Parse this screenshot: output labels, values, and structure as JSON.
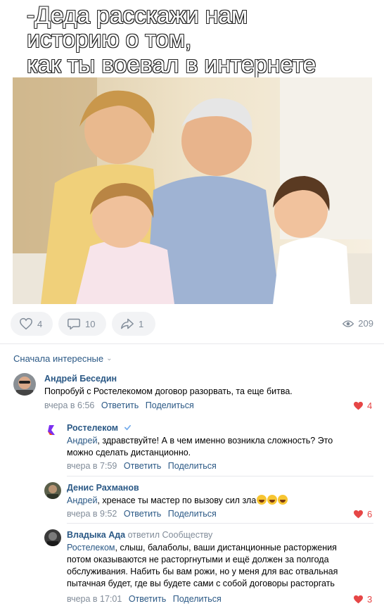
{
  "meme": {
    "lines": [
      "-Деда расскажи нам",
      "историю о том,",
      "как ты воевал в интернете"
    ]
  },
  "post_actions": {
    "likes": "4",
    "comments": "10",
    "shares": "1",
    "views": "209"
  },
  "sort": {
    "label": "Сначала интересные"
  },
  "comments": [
    {
      "author": "Андрей Беседин",
      "text": "Попробуй с Ростелекомом договор разорвать, та еще битва.",
      "time": "вчера в 6:56",
      "reply_label": "Ответить",
      "share_label": "Поделиться",
      "likes": "4"
    },
    {
      "author": "Ростелеком",
      "addressee": "Андрей",
      "text": ", здравствуйте! А в чем именно возникла сложность? Это можно сделать дистанционно.",
      "time": "вчера в 7:59",
      "reply_label": "Ответить",
      "share_label": "Поделиться"
    },
    {
      "author": "Денис Рахманов",
      "addressee": "Андрей",
      "text": ", хренасе ты мастер по вызову сил зла",
      "time": "вчера в 9:52",
      "reply_label": "Ответить",
      "share_label": "Поделиться",
      "likes": "6"
    },
    {
      "author": "Владыка Ада",
      "replied_to": "ответил Сообществу",
      "addressee": "Ростелеком",
      "text": ", слыш, балаболы, ваши дистанционные расторжения потом оказываются не расторгнутыми и ещё должен за полгода обслуживания. Набить бы вам рожи, но у меня для вас отвальная пытачная будет, где вы будете сами с собой договоры расторгать",
      "time": "вчера в 17:01",
      "reply_label": "Ответить",
      "share_label": "Поделиться",
      "likes": "3"
    }
  ],
  "colors": {
    "link": "#2a5885",
    "muted": "#818c99",
    "like_red": "#e64646",
    "pill_bg": "#f2f3f5"
  }
}
